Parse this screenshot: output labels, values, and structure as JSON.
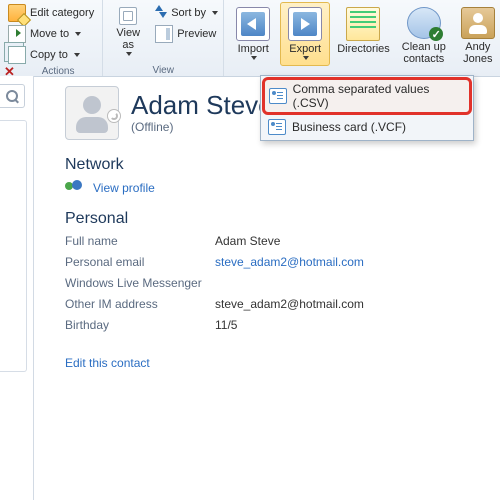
{
  "ribbon": {
    "actions": {
      "edit_category": "Edit category",
      "move_to": "Move to",
      "copy_to": "Copy to",
      "group_label": "Actions"
    },
    "view": {
      "view_as": "View\nas",
      "sort_by": "Sort by",
      "preview": "Preview",
      "group_label": "View"
    },
    "tools": {
      "import": "Import",
      "export": "Export",
      "directories": "Directories",
      "cleanup": "Clean up\ncontacts",
      "user": "Andy\nJones"
    },
    "export_menu": {
      "csv": "Comma separated values (.CSV)",
      "vcf": "Business card (.VCF)"
    }
  },
  "contact": {
    "name": "Adam Steve",
    "status": "(Offline)",
    "network_title": "Network",
    "view_profile": "View profile",
    "personal_title": "Personal",
    "fields": {
      "full_name_label": "Full name",
      "full_name_value": "Adam Steve",
      "email_label": "Personal email",
      "email_value": "steve_adam2@hotmail.com",
      "wlm_label": "Windows Live Messenger",
      "wlm_value": "",
      "im_label": "Other IM address",
      "im_value": "steve_adam2@hotmail.com",
      "birthday_label": "Birthday",
      "birthday_value": "11/5"
    },
    "edit_link": "Edit this contact"
  }
}
